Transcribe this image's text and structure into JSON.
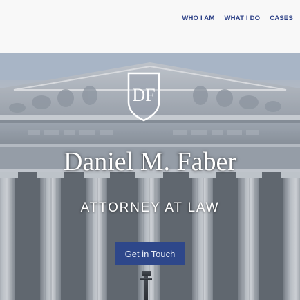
{
  "nav": {
    "links": [
      {
        "label": "WHO I AM"
      },
      {
        "label": "WHAT I DO"
      },
      {
        "label": "CASES"
      }
    ]
  },
  "hero": {
    "logo_letters": "DF",
    "name": "Daniel M. Faber",
    "subtitle": "ATTORNEY AT LAW",
    "cta_label": "Get in Touch"
  },
  "colors": {
    "nav_text": "#2b3f86",
    "cta_background": "#2e478a",
    "hero_text": "#ffffff"
  }
}
